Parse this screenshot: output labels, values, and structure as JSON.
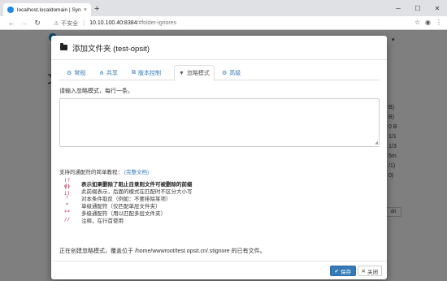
{
  "browser": {
    "tab_title": "localhost.localdomain | Syncthing",
    "tab_close": "×",
    "new_tab": "+",
    "security_label": "不安全",
    "url_host": "10.10.100.40:8384",
    "url_path": "/#folder-ignores"
  },
  "page_bg": {
    "heading_char": "文",
    "right_column": [
      "B)",
      "B)",
      "0 B",
      "1/1",
      "1/3",
      "5m",
      "/1)",
      "0)"
    ],
    "btn_fragment": "dit"
  },
  "modal": {
    "title": "添加文件夹 (test-opsit)",
    "tabs": [
      {
        "icon": "gear-icon",
        "label": "常规"
      },
      {
        "icon": "share-icon",
        "label": "共享"
      },
      {
        "icon": "copy-icon",
        "label": "版本控制"
      },
      {
        "icon": "filter-icon",
        "label": "忽略模式"
      },
      {
        "icon": "cogs-icon",
        "label": "高级"
      }
    ],
    "hint": "请输入忽略模式，每行一条。",
    "textarea_value": "",
    "reference_prefix": "支持的通配符的简单教程：",
    "reference_link": "(完整文档)",
    "rules": [
      {
        "code": "(?d)",
        "desc": "表示如果删除了阻止目录则文件可被删除的前缀",
        "bold": true
      },
      {
        "code": "(?i)",
        "desc": "此前缀表示，后面的模式在匹配时不区分大小写",
        "bold": false
      },
      {
        "code": "!",
        "desc": "对本条件取反（例如：不要排除某项）",
        "bold": false
      },
      {
        "code": "*",
        "desc": "单级通配符（仅匹配单层文件夹）",
        "bold": false
      },
      {
        "code": "**",
        "desc": "多级通配符（用以匹配多层文件夹）",
        "bold": false
      },
      {
        "code": "//",
        "desc": "注释，在行首使用",
        "bold": false
      }
    ],
    "note": "正在创建忽略模式，覆盖位于 /home/wwwroot/test.opsit.cn/.stignore 的已有文件。",
    "save_label": "保存",
    "close_label": "关闭"
  },
  "colors": {
    "primary": "#337ab7",
    "code": "#c7254e",
    "brand": "#0891d1"
  }
}
